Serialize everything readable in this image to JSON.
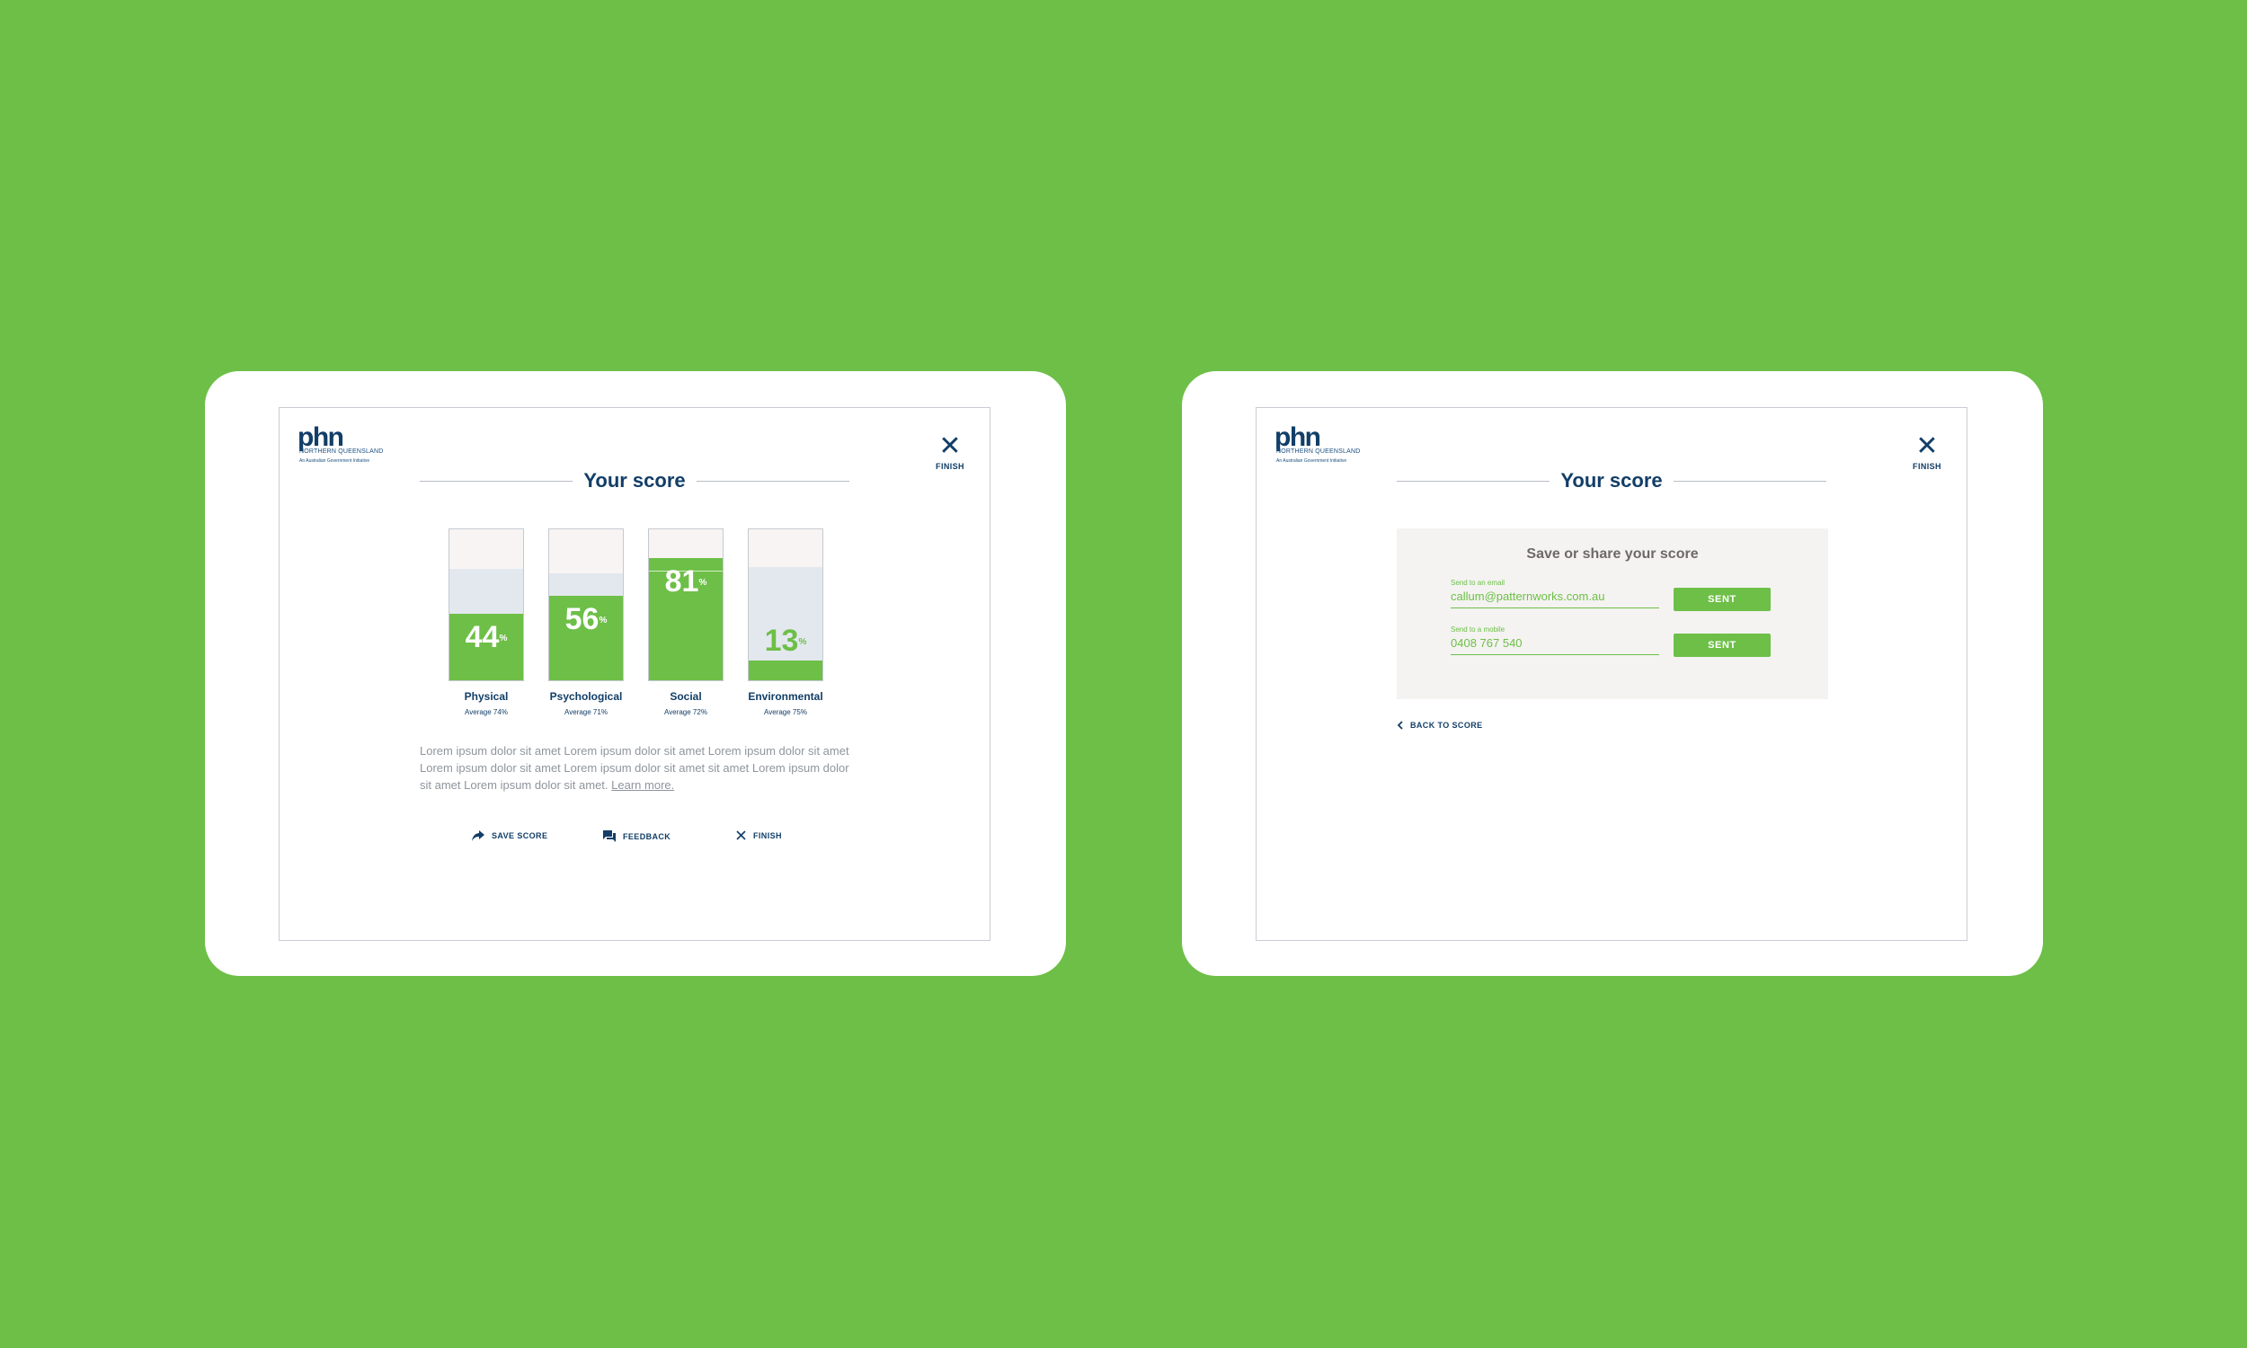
{
  "colors": {
    "background": "#6dbf47",
    "brand_navy": "#123e67",
    "accent_green": "#6dbf47",
    "average_fill": "#e3e8ef",
    "bar_empty": "#f7f4f3",
    "panel_bg": "#f4f3f1"
  },
  "brand": {
    "logo_main": "phn",
    "logo_sub": "NORTHERN QUEENSLAND",
    "logo_tag": "An Australian Government Initiative"
  },
  "score_screen": {
    "title": "Your score",
    "finish_label": "FINISH",
    "bars": [
      {
        "name": "Physical",
        "score": 44,
        "score_label": "44",
        "average": 74,
        "average_label": "Average 74%"
      },
      {
        "name": "Psychological",
        "score": 56,
        "score_label": "56",
        "average": 71,
        "average_label": "Average 71%"
      },
      {
        "name": "Social",
        "score": 81,
        "score_label": "81",
        "average": 72,
        "average_label": "Average 72%"
      },
      {
        "name": "Environmental",
        "score": 13,
        "score_label": "13",
        "average": 75,
        "average_label": "Average 75%"
      }
    ],
    "percent_sign": "%",
    "body_text": "Lorem ipsum dolor sit amet Lorem ipsum dolor sit amet Lorem ipsum dolor sit amet Lorem ipsum dolor sit amet Lorem ipsum dolor sit amet sit amet Lorem ipsum dolor sit amet Lorem ipsum dolor sit amet.",
    "learn_more": "Learn more.",
    "actions": {
      "save": "SAVE SCORE",
      "feedback": "FEEDBACK",
      "finish": "FINISH"
    },
    "icons": {
      "save": "share-arrow-icon",
      "feedback": "chat-bubbles-icon",
      "finish": "close-icon"
    }
  },
  "share_screen": {
    "title": "Your score",
    "finish_label": "FINISH",
    "panel_title": "Save or share your score",
    "email_label": "Send to an email",
    "email_value": "callum@patternworks.com.au",
    "mobile_label": "Send to a mobile",
    "mobile_value": "0408 767 540",
    "sent_label": "SENT",
    "back_label": "BACK TO SCORE",
    "icons": {
      "back": "chevron-left-icon"
    }
  }
}
